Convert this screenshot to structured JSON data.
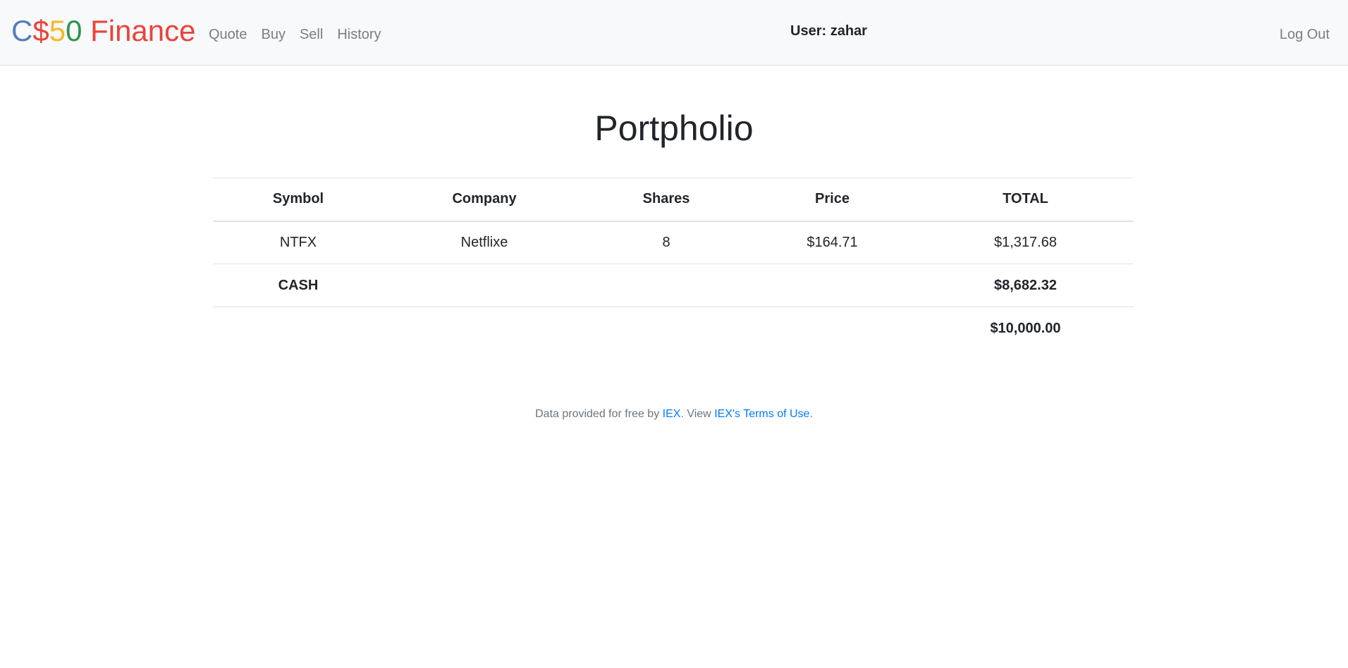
{
  "brand": {
    "part1": "C",
    "part2": "$",
    "part3": "5",
    "part4": "0",
    "part5": " Finance",
    "colors": {
      "blue": "#537fbe",
      "red": "#ea433b",
      "yellow": "#f5b82e",
      "green": "#2e944b"
    }
  },
  "nav": {
    "links": [
      {
        "label": "Quote"
      },
      {
        "label": "Buy"
      },
      {
        "label": "Sell"
      },
      {
        "label": "History"
      }
    ],
    "user_label": "User: zahar",
    "logout_label": "Log Out"
  },
  "main": {
    "title": "Portpholio",
    "table": {
      "headers": [
        "Symbol",
        "Company",
        "Shares",
        "Price",
        "TOTAL"
      ],
      "rows": [
        {
          "symbol": "NTFX",
          "company": "Netflixe",
          "shares": "8",
          "price": "$164.71",
          "total": "$1,317.68"
        }
      ],
      "cash": {
        "label": "CASH",
        "total": "$8,682.32"
      },
      "grand_total": "$10,000.00"
    }
  },
  "footer": {
    "prefix": "Data provided for free by ",
    "iex_link": "IEX",
    "middle": ". View ",
    "terms_link": "IEX's Terms of Use",
    "suffix": ".",
    "link_color": "#007bff"
  }
}
